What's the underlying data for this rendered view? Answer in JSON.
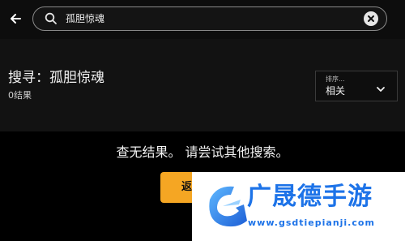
{
  "search": {
    "query": "孤胆惊魂"
  },
  "results": {
    "title": "搜寻：孤胆惊魂",
    "count": "0结果"
  },
  "sort": {
    "label": "排序...",
    "value": "相关"
  },
  "empty": {
    "message": "查无结果。 请尝试其他搜索。",
    "button_label": "返"
  },
  "watermark": {
    "title": "广晟德手游",
    "url": "www.gsdtiepianji.com"
  },
  "colors": {
    "accent": "#f5a623",
    "watermark_blue": "#1d73e8"
  }
}
